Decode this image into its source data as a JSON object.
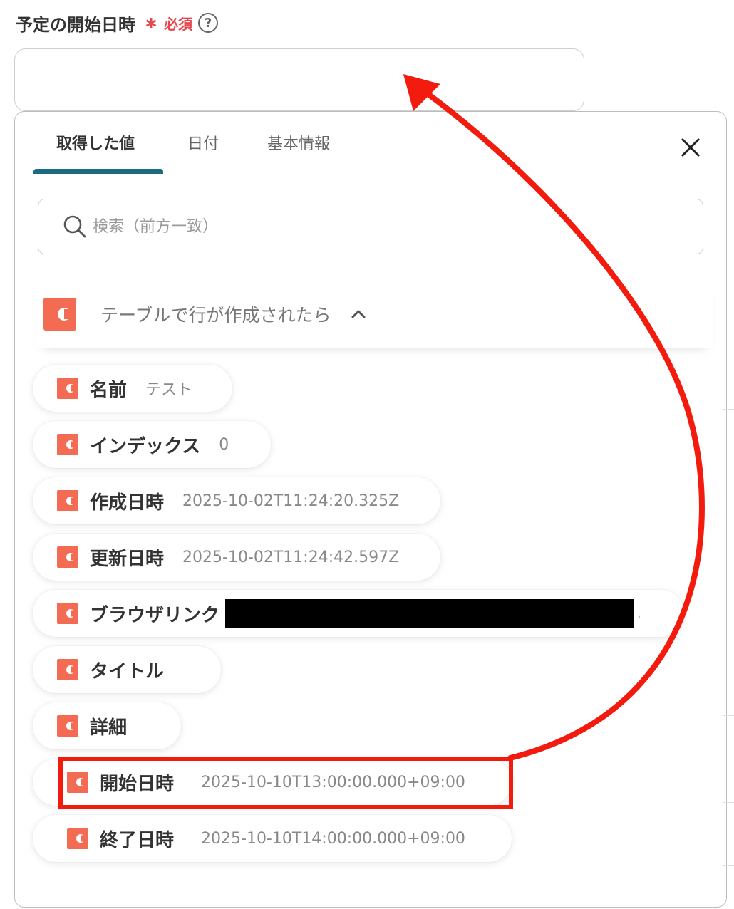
{
  "field": {
    "label": "予定の開始日時",
    "required_mark": "∗",
    "required_text": "必須",
    "help_icon": "question-circle-icon",
    "value": ""
  },
  "tabs": [
    {
      "label": "取得した値",
      "active": true
    },
    {
      "label": "日付",
      "active": false
    },
    {
      "label": "基本情報",
      "active": false
    }
  ],
  "close_icon": "close-icon",
  "search": {
    "placeholder": "検索（前方一致）",
    "icon": "search-icon"
  },
  "group": {
    "title": "テーブルで行が作成されたら",
    "icon": "app-logo-icon",
    "expanded": true
  },
  "items": [
    {
      "name": "名前",
      "value": "テスト"
    },
    {
      "name": "インデックス",
      "value": "0"
    },
    {
      "name": "作成日時",
      "value": "2025-10-02T11:24:20.325Z"
    },
    {
      "name": "更新日時",
      "value": "2025-10-02T11:24:42.597Z"
    },
    {
      "name": "ブラウザリンク",
      "value": "",
      "redacted": true
    },
    {
      "name": "タイトル",
      "value": ""
    },
    {
      "name": "詳細",
      "value": ""
    },
    {
      "name": "開始日時",
      "value": "2025-10-10T13:00:00.000+09:00",
      "highlighted": true
    },
    {
      "name": "終了日時",
      "value": "2025-10-10T14:00:00.000+09:00"
    }
  ],
  "colors": {
    "brand": "#f26b52",
    "required": "#e8474f",
    "tab_underline": "#1a6b7d",
    "highlight": "#f31b0e",
    "arrow": "#f31b0e"
  }
}
